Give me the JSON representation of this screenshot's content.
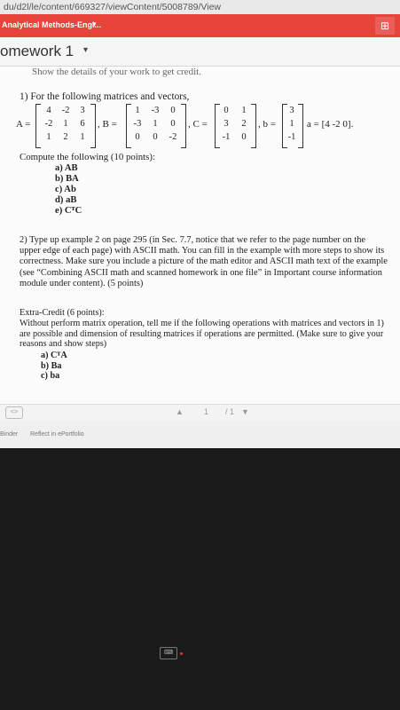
{
  "browser": {
    "url": "du/d2l/le/content/669327/viewContent/5008789/View"
  },
  "nav": {
    "course": "Analytical Methods-Engi...",
    "caret": "▾",
    "menu": "⊞"
  },
  "header": {
    "title": "omework 1",
    "caret": "▾"
  },
  "doc": {
    "cut_line": "Show the details of your work to get credit.",
    "q1_intro": "1)  For the following matrices and vectors,",
    "A": [
      [
        "4",
        "-2",
        "3"
      ],
      [
        "-2",
        "1",
        "6"
      ],
      [
        "1",
        "2",
        "1"
      ]
    ],
    "B": [
      [
        "1",
        "-3",
        "0"
      ],
      [
        "-3",
        "1",
        "0"
      ],
      [
        "0",
        "0",
        "-2"
      ]
    ],
    "C": [
      [
        "0",
        "1"
      ],
      [
        "3",
        "2"
      ],
      [
        "-1",
        "0"
      ]
    ],
    "b": [
      "3",
      "1",
      "-1"
    ],
    "a_text": "a = [4  -2  0].",
    "labels": {
      "A": "A =",
      "B": ", B =",
      "C": ", C =",
      "b": ", b ="
    },
    "compute": "Compute the following (10 points):",
    "items": [
      "a)   AB",
      "b)   BA",
      "c)   Ab",
      "d)   aB",
      "e)   CᵀC"
    ],
    "q2": "2) Type up example 2 on page 295 (in Sec. 7.7, notice that we refer to the page number on the upper edge of each page) with ASCII math.  You can fill in the example with more steps to show its correctness.  Make sure you include a picture of the math editor and ASCII math text of the example (see “Combining ASCII math and scanned homework in one file” in Important course information module under content).  (5 points)",
    "extra_title": "Extra-Credit (6 points):",
    "extra_body": "Without perform matrix operation, tell me if the following operations with matrices and vectors in 1) are possible and dimension of resulting matrices if operations are permitted. (Make sure to give your reasons and show steps)",
    "extra_items": [
      "a)  CᵀA",
      "b)  Ba",
      "c)  ba"
    ]
  },
  "pager": {
    "icon": "<>",
    "up": "▲",
    "page": "1",
    "total": "/ 1",
    "down": "▼"
  },
  "footer": {
    "binder": "Binder",
    "reflect": "Reflect in ePortfolio"
  },
  "taskbar": {
    "icon": "⌨"
  }
}
